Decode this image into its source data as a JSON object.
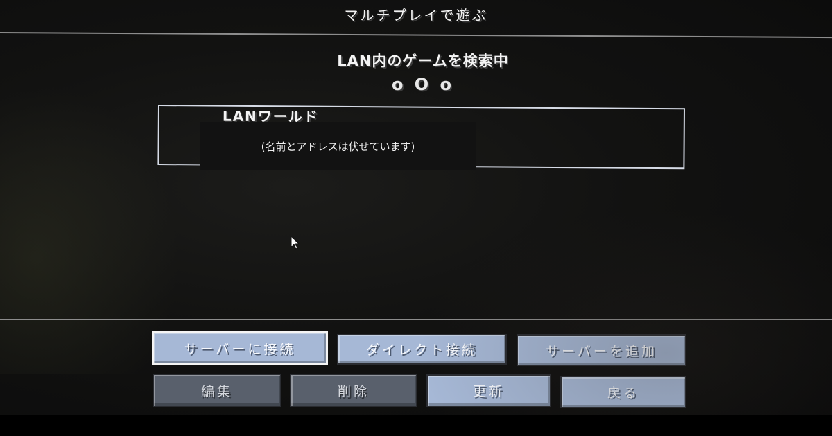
{
  "screen": {
    "title": "マルチプレイで遊ぶ"
  },
  "lan_scan": {
    "heading": "LAN内のゲームを検索中",
    "indicator": "o O o"
  },
  "lan_entry": {
    "label": "LANワールド",
    "privacy_note": "(名前とアドレスは伏せています)"
  },
  "buttons": {
    "row1": [
      "サーバーに接続",
      "ダイレクト接続",
      "サーバーを追加"
    ],
    "row2": [
      "編集",
      "削除",
      "更新",
      "戻る"
    ]
  },
  "colors": {
    "button_enabled": "#a6b8d6",
    "button_disabled": "#59606c",
    "background": "#121211"
  }
}
